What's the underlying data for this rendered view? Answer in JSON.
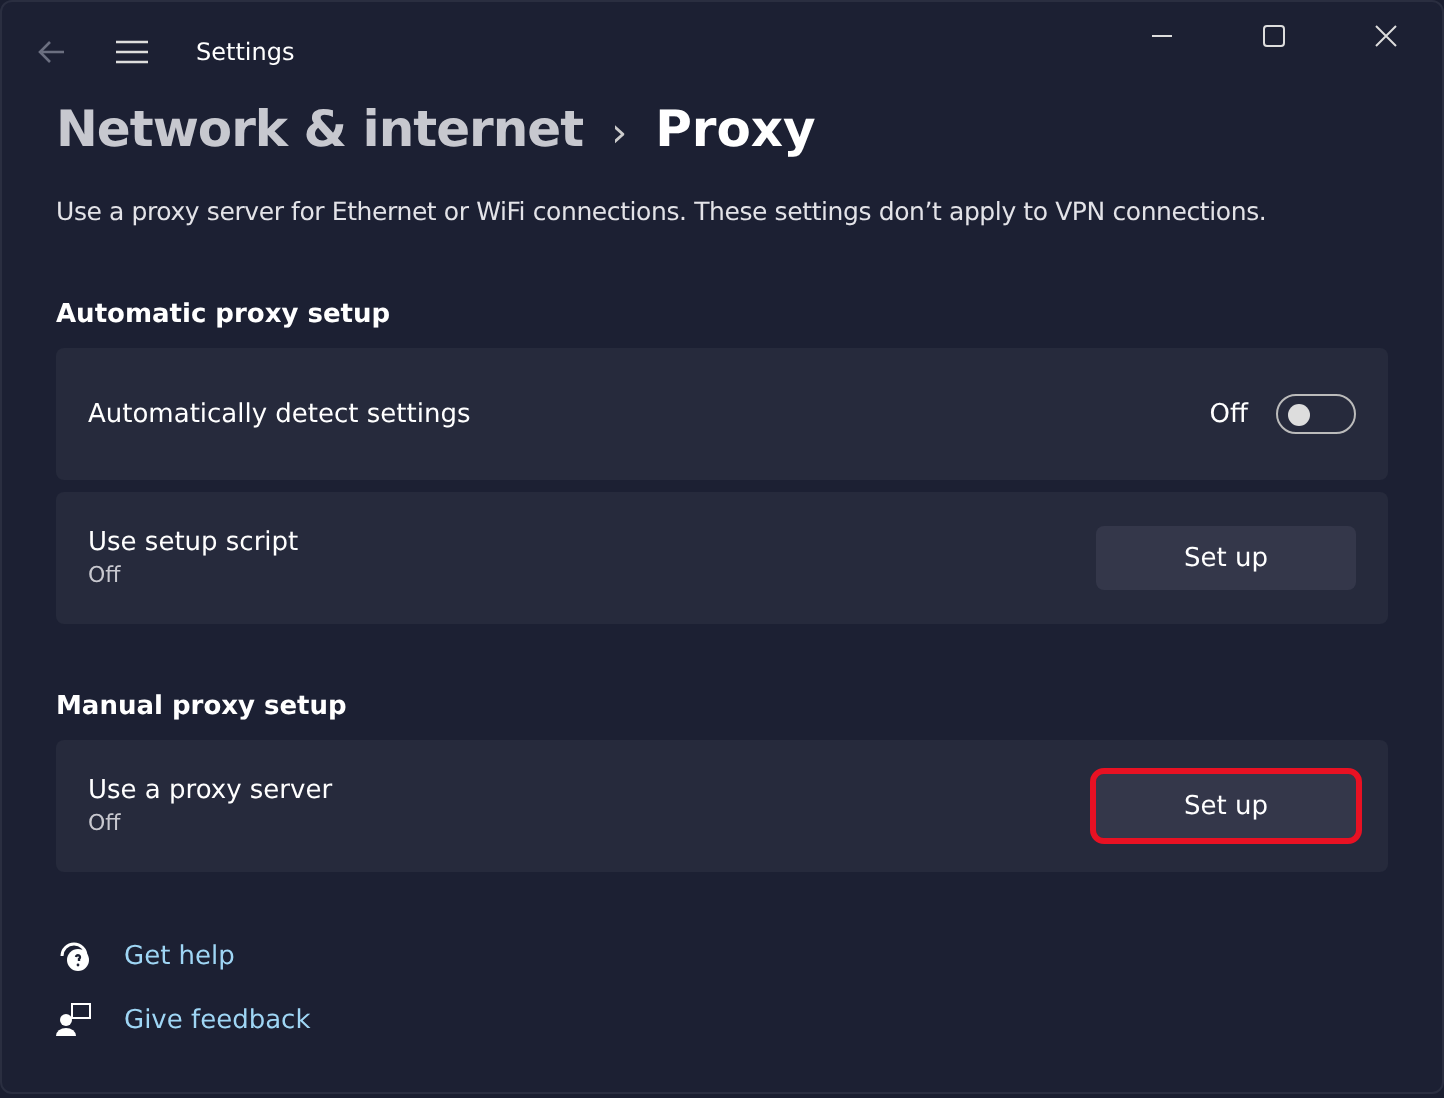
{
  "window": {
    "title": "Settings"
  },
  "breadcrumb": {
    "parent": "Network & internet",
    "separator": "›",
    "current": "Proxy"
  },
  "description": "Use a proxy server for Ethernet or WiFi connections. These settings don’t apply to VPN connections.",
  "sections": [
    {
      "title": "Automatic proxy setup",
      "cards": [
        {
          "kind": "toggle",
          "label": "Automatically detect settings",
          "state_text": "Off",
          "on": false
        },
        {
          "kind": "button",
          "label": "Use setup script",
          "subtitle": "Off",
          "button": "Set up",
          "highlighted": false
        }
      ]
    },
    {
      "title": "Manual proxy setup",
      "cards": [
        {
          "kind": "button",
          "label": "Use a proxy server",
          "subtitle": "Off",
          "button": "Set up",
          "highlighted": true
        }
      ]
    }
  ],
  "links": [
    {
      "kind": "help",
      "label": "Get help"
    },
    {
      "kind": "feedback",
      "label": "Give feedback"
    }
  ]
}
